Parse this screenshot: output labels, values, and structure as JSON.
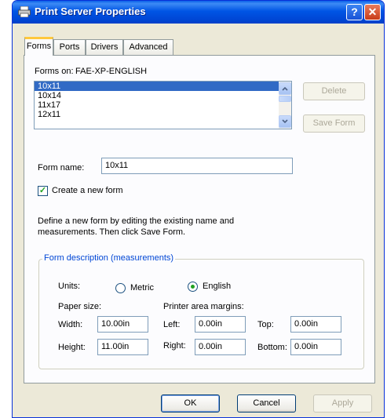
{
  "window": {
    "title": "Print Server Properties",
    "help_label": "?",
    "close_label": "✕"
  },
  "tabs": [
    {
      "label": "Forms",
      "active": true
    },
    {
      "label": "Ports",
      "active": false
    },
    {
      "label": "Drivers",
      "active": false
    },
    {
      "label": "Advanced",
      "active": false
    }
  ],
  "forms": {
    "forms_on_label": "Forms on:",
    "server_name": "FAE-XP-ENGLISH",
    "list_items": [
      "10x11",
      "10x14",
      "11x17",
      "12x11"
    ],
    "selected_item": "10x11",
    "delete_label": "Delete",
    "save_form_label": "Save Form",
    "form_name_label": "Form name:",
    "form_name_value": "10x11",
    "create_new_label": "Create a new form",
    "create_new_checked": true,
    "description_line1": "Define a new form by editing the existing name and",
    "description_line2": "measurements.  Then click Save Form."
  },
  "measurements": {
    "group_title": "Form description (measurements)",
    "units_label": "Units:",
    "metric_label": "Metric",
    "english_label": "English",
    "selected_unit": "English",
    "paper_size_label": "Paper size:",
    "printer_margins_label": "Printer area margins:",
    "width_label": "Width:",
    "width_value": "10.00in",
    "height_label": "Height:",
    "height_value": "11.00in",
    "left_label": "Left:",
    "left_value": "0.00in",
    "top_label": "Top:",
    "top_value": "0.00in",
    "right_label": "Right:",
    "right_value": "0.00in",
    "bottom_label": "Bottom:",
    "bottom_value": "0.00in"
  },
  "footer": {
    "ok_label": "OK",
    "cancel_label": "Cancel",
    "apply_label": "Apply"
  },
  "colors": {
    "titlebar": "#0055e5",
    "selection": "#316ac5",
    "group_title": "#0046d5",
    "check": "#21a121"
  }
}
